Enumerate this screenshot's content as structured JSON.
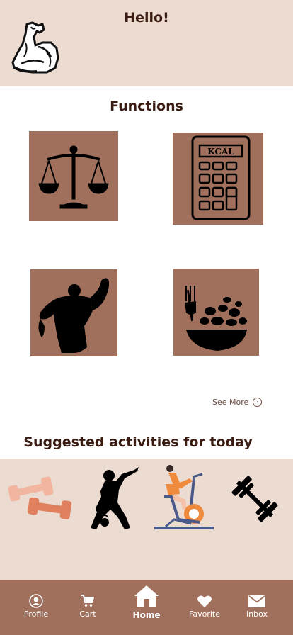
{
  "header": {
    "greeting": "Hello!"
  },
  "functions": {
    "title": "Functions",
    "tiles": [
      {
        "icon": "balance-scale-icon"
      },
      {
        "icon": "calculator-icon",
        "text": "KCAL"
      },
      {
        "icon": "bodybuilder-icon"
      },
      {
        "icon": "food-bowl-icon"
      }
    ],
    "see_more": "See More"
  },
  "suggestions": {
    "title": "Suggested activities for today",
    "items": [
      {
        "icon": "dumbbells-icon"
      },
      {
        "icon": "kettlebell-workout-icon"
      },
      {
        "icon": "exercise-bike-icon"
      },
      {
        "icon": "barbell-icon"
      }
    ]
  },
  "tabbar": {
    "items": [
      {
        "label": "Profile",
        "icon": "user-icon"
      },
      {
        "label": "Cart",
        "icon": "cart-icon"
      },
      {
        "label": "Home",
        "icon": "home-icon"
      },
      {
        "label": "Favorite",
        "icon": "heart-icon"
      },
      {
        "label": "Inbox",
        "icon": "mail-icon"
      }
    ]
  },
  "colors": {
    "header_bg": "#ecdbd0",
    "tile_bg": "#a0705c",
    "tabbar_bg": "#a0705c",
    "text_dark": "#3a1c12"
  }
}
